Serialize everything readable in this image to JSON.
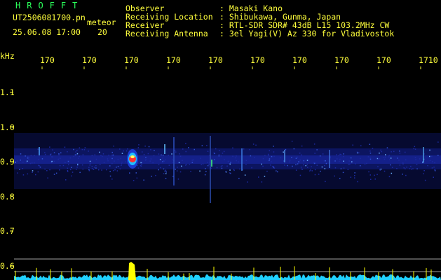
{
  "header": {
    "brand": "HROFFT",
    "filename": "UT2506081700.pn",
    "mode": "meteor",
    "datetime": "25.06.08 17:00",
    "counter": "20",
    "fields": [
      {
        "label": "Observer",
        "value": ": Masaki Kano"
      },
      {
        "label": "Receiving Location",
        "value": ": Shibukawa, Gunma, Japan"
      },
      {
        "label": "Receiver",
        "value": ": RTL-SDR SDR# 43dB L15 103.2MHz CW"
      },
      {
        "label": "Receiving Antenna",
        "value": ": 3el Yagi(V) Az 330 for Vladivostok"
      }
    ]
  },
  "axis": {
    "unit": "kHz",
    "y_ticks": [
      "1.1",
      "1.0",
      "0.9",
      "0.8",
      "0.7",
      "0.6"
    ],
    "x_ticks": [
      "170",
      "170",
      "170",
      "170",
      "170",
      "170",
      "170",
      "170",
      "170",
      "1710"
    ]
  },
  "colors": {
    "text": "#ffff3c",
    "brand": "#2aff5a",
    "background": "#000000",
    "signal_band": "#1a2a8a",
    "trace": "#ffff00",
    "noise_floor": "#20d0ff"
  }
}
